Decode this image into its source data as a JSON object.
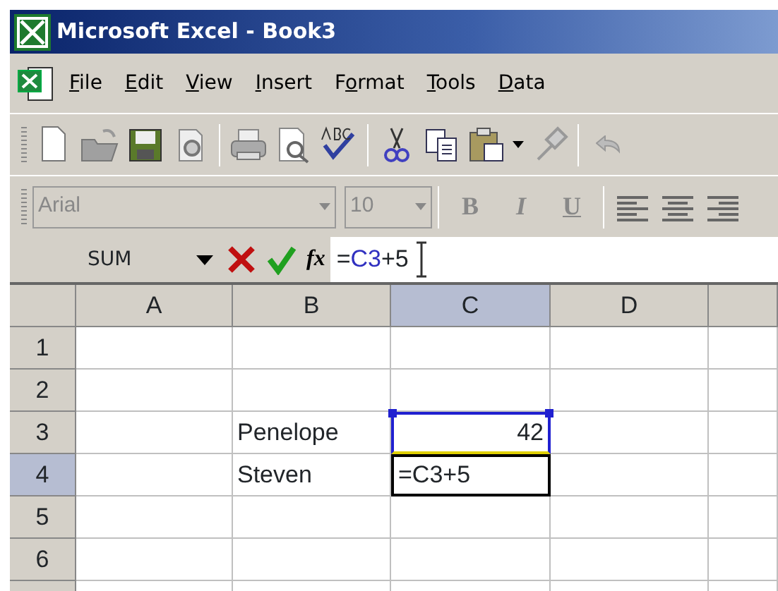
{
  "window": {
    "title": "Microsoft Excel - Book3"
  },
  "menu": [
    {
      "key": "F",
      "after": "ile"
    },
    {
      "key": "E",
      "after": "dit"
    },
    {
      "key": "V",
      "after": "iew"
    },
    {
      "key": "I",
      "after": "nsert"
    },
    {
      "before": "F",
      "key": "o",
      "after": "rmat"
    },
    {
      "key": "T",
      "after": "ools"
    },
    {
      "key": "D",
      "after": "ata"
    }
  ],
  "format_toolbar": {
    "font": {
      "value": "Arial",
      "disabled": true
    },
    "size": {
      "value": "10",
      "disabled": true
    },
    "styles": [
      {
        "label": "B",
        "kind": "bold"
      },
      {
        "label": "I",
        "kind": "italic"
      },
      {
        "label": "U",
        "kind": "underline"
      }
    ]
  },
  "formula_bar": {
    "name_box": "SUM",
    "function_button": "fx",
    "formula": [
      {
        "text": "=",
        "reference": false
      },
      {
        "text": "C3",
        "reference": true
      },
      {
        "text": "+5",
        "reference": false
      }
    ]
  },
  "columns": [
    {
      "label": "A",
      "selected": false
    },
    {
      "label": "B",
      "selected": false
    },
    {
      "label": "C",
      "selected": true
    },
    {
      "label": "D",
      "selected": false
    }
  ],
  "rows": [
    {
      "label": "1",
      "selected": false
    },
    {
      "label": "2",
      "selected": false
    },
    {
      "label": "3",
      "selected": false,
      "cells": {
        "b": {
          "text": "Penelope"
        },
        "c": {
          "text": "42",
          "right_aligned": true,
          "referenced": true
        }
      }
    },
    {
      "label": "4",
      "selected": true,
      "cells": {
        "b": {
          "text": "Steven"
        },
        "c": {
          "text": "=C3+5",
          "editing": true
        }
      }
    },
    {
      "label": "5",
      "selected": false
    },
    {
      "label": "6",
      "selected": false
    }
  ]
}
